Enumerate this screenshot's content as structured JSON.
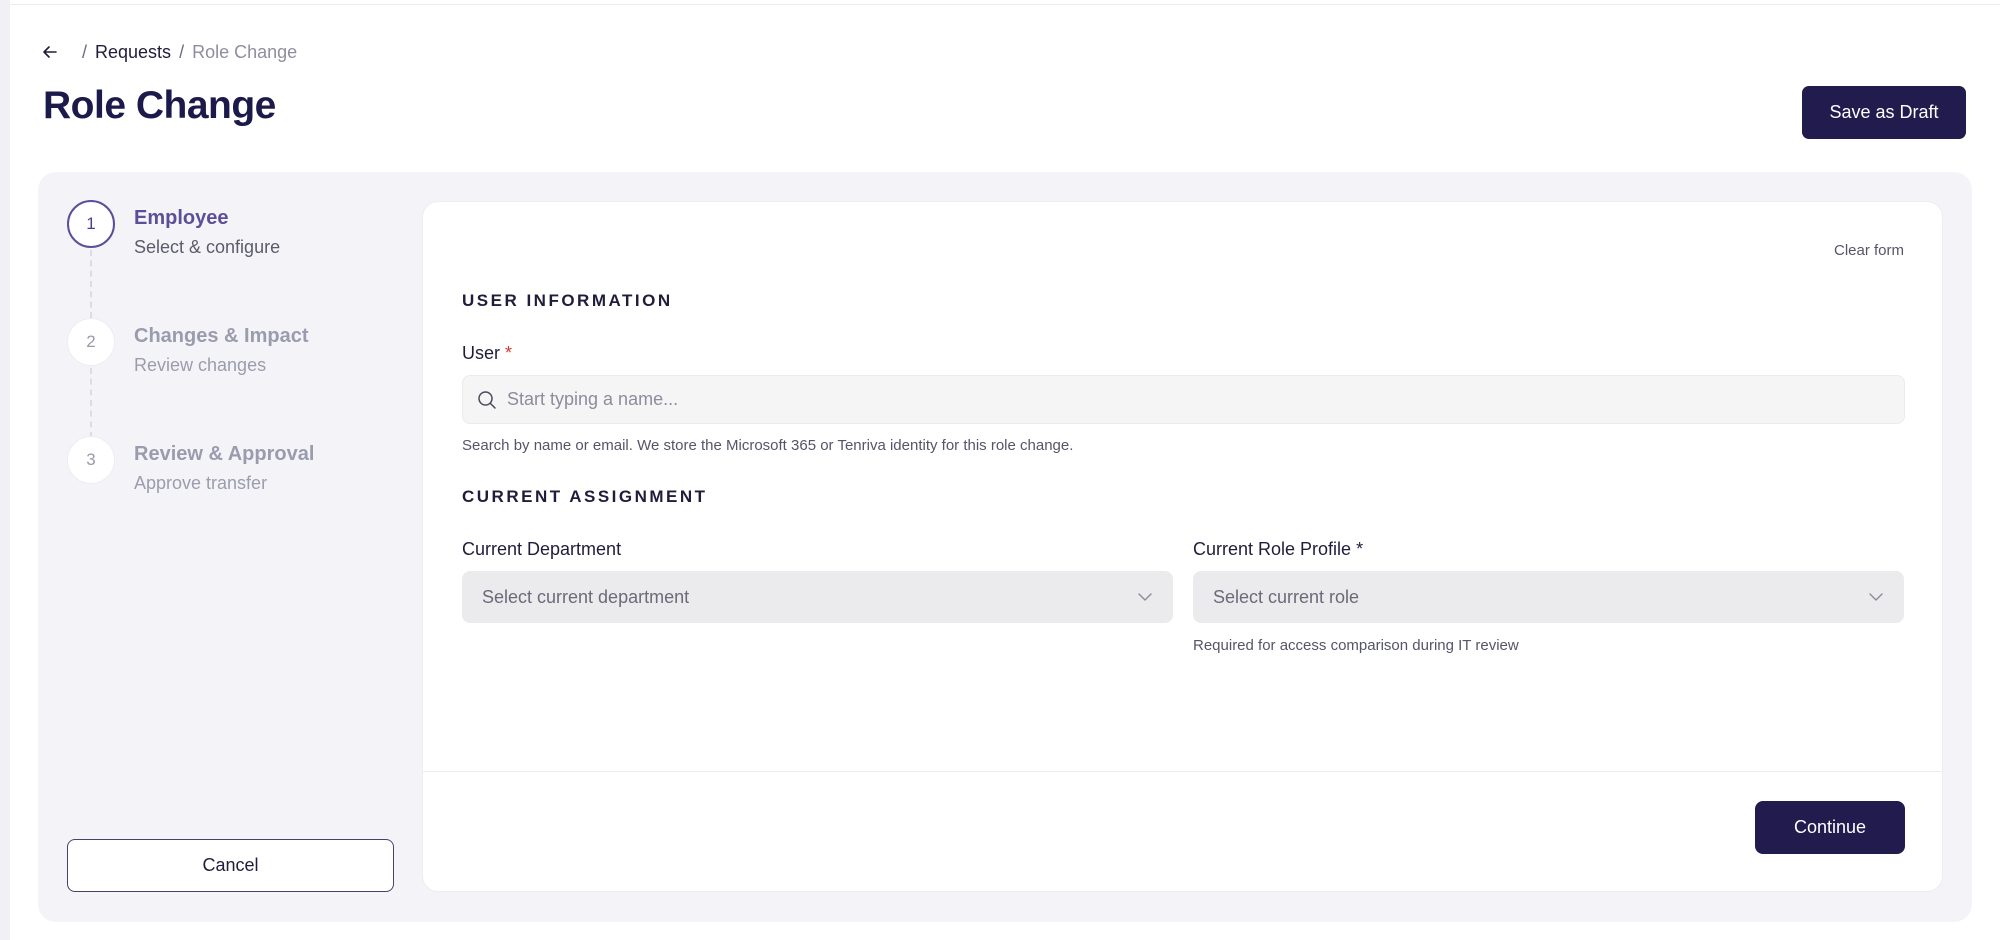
{
  "breadcrumb": {
    "back_icon": "arrow-left-icon",
    "separator": "/",
    "parent": "Requests",
    "current": "Role Change"
  },
  "page": {
    "title": "Role Change",
    "save_draft_label": "Save as Draft"
  },
  "steps": [
    {
      "number": "1",
      "title": "Employee",
      "subtitle": "Select & configure",
      "state": "active"
    },
    {
      "number": "2",
      "title": "Changes & Impact",
      "subtitle": "Review changes",
      "state": "inactive"
    },
    {
      "number": "3",
      "title": "Review & Approval",
      "subtitle": "Approve transfer",
      "state": "inactive"
    }
  ],
  "cancel_label": "Cancel",
  "form": {
    "clear_label": "Clear form",
    "user_section_title": "USER INFORMATION",
    "user_label": "User",
    "required_marker": "*",
    "user_placeholder": "Start typing a name...",
    "user_value": "",
    "search_icon": "search-icon",
    "user_help": "Search by name or email. We store the Microsoft 365 or Tenriva identity for this role change.",
    "assignment_section_title": "CURRENT ASSIGNMENT",
    "department_label": "Current Department",
    "department_placeholder": "Select current department",
    "role_label": "Current Role Profile *",
    "role_placeholder": "Select current role",
    "chevron_icon": "chevron-down-icon",
    "role_help": "Required for access comparison during IT review"
  },
  "continue_label": "Continue",
  "colors": {
    "primary": "#211b4e",
    "active_step": "#5d4f97",
    "required": "#d2383a",
    "panel_bg": "#f4f4f8"
  }
}
